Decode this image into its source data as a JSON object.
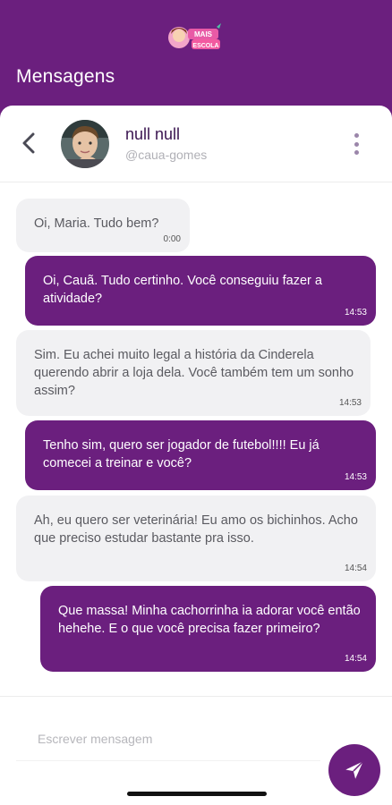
{
  "header": {
    "title": "Mensagens",
    "logo": {
      "alt": "logo-icon"
    }
  },
  "chat": {
    "contact_name": "null null",
    "contact_handle": "@caua-gomes"
  },
  "messages": [
    {
      "direction": "in",
      "text": "Oi, Maria. Tudo bem?",
      "time": "0:00"
    },
    {
      "direction": "out",
      "text": "Oi, Cauã. Tudo certinho. Você conseguiu fazer a atividade?",
      "time": "14:53"
    },
    {
      "direction": "in",
      "text": "Sim. Eu achei muito legal a história da Cinderela querendo abrir a loja dela. Você também tem um sonho assim?",
      "time": "14:53"
    },
    {
      "direction": "out",
      "text": "Tenho sim, quero ser jogador de futebol!!!! Eu já comecei a treinar e você?",
      "time": "14:53"
    },
    {
      "direction": "in",
      "text": "Ah, eu quero ser veterinária! Eu amo os bichinhos. Acho que preciso estudar bastante pra isso.",
      "time": "14:54"
    },
    {
      "direction": "out",
      "text": "Que massa! Minha cachorrinha ia adorar você então hehehe. E o que você precisa fazer primeiro?",
      "time": "14:54"
    }
  ],
  "composer": {
    "placeholder": "Escrever mensagem"
  },
  "colors": {
    "brand_purple": "#6b1f7e",
    "incoming_bubble": "#f1f1f3"
  }
}
